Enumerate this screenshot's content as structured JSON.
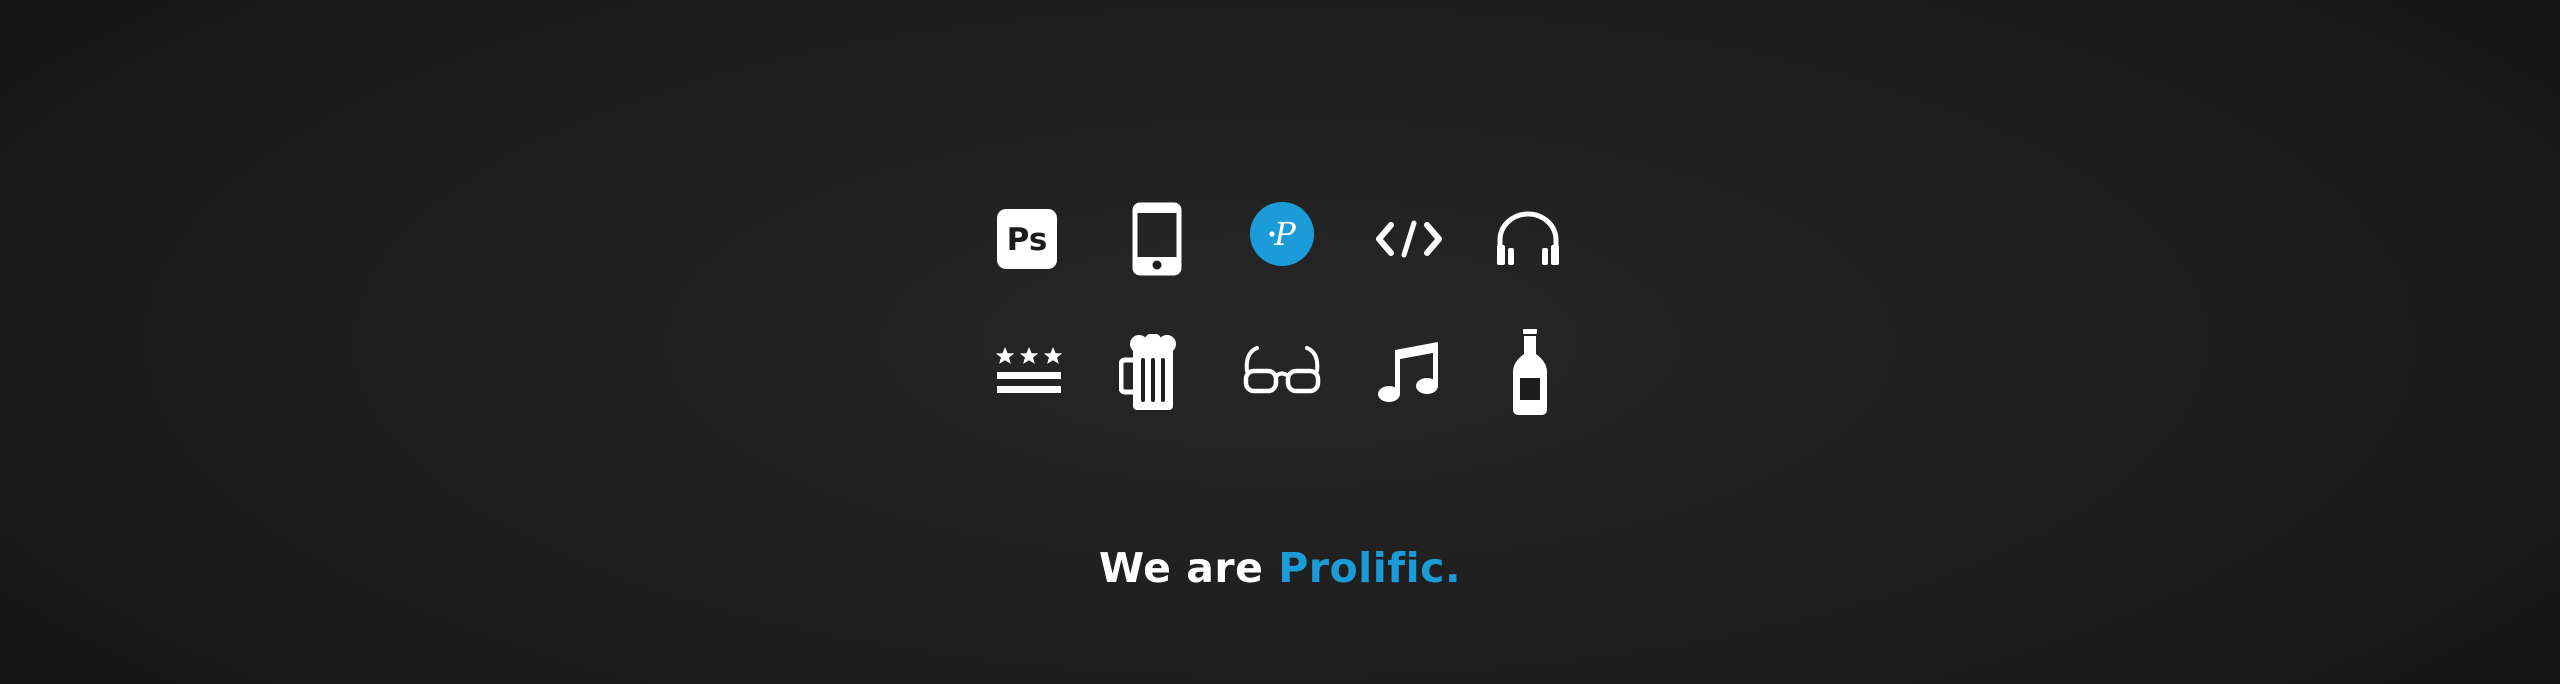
{
  "icons": {
    "row1": [
      "photoshop-icon",
      "smartphone-icon",
      "prolific-logo-icon",
      "code-icon",
      "headphones-icon"
    ],
    "row2": [
      "dc-flag-icon",
      "beer-mug-icon",
      "glasses-icon",
      "music-note-icon",
      "beer-bottle-icon"
    ]
  },
  "logo": {
    "photoshop_text": "Ps",
    "prolific_mark_text": "P"
  },
  "tagline": {
    "prefix": "We are ",
    "brand": "Prolific."
  },
  "colors": {
    "accent": "#1b9bd8",
    "icon": "#ffffff",
    "background": "#1f1f1f"
  }
}
